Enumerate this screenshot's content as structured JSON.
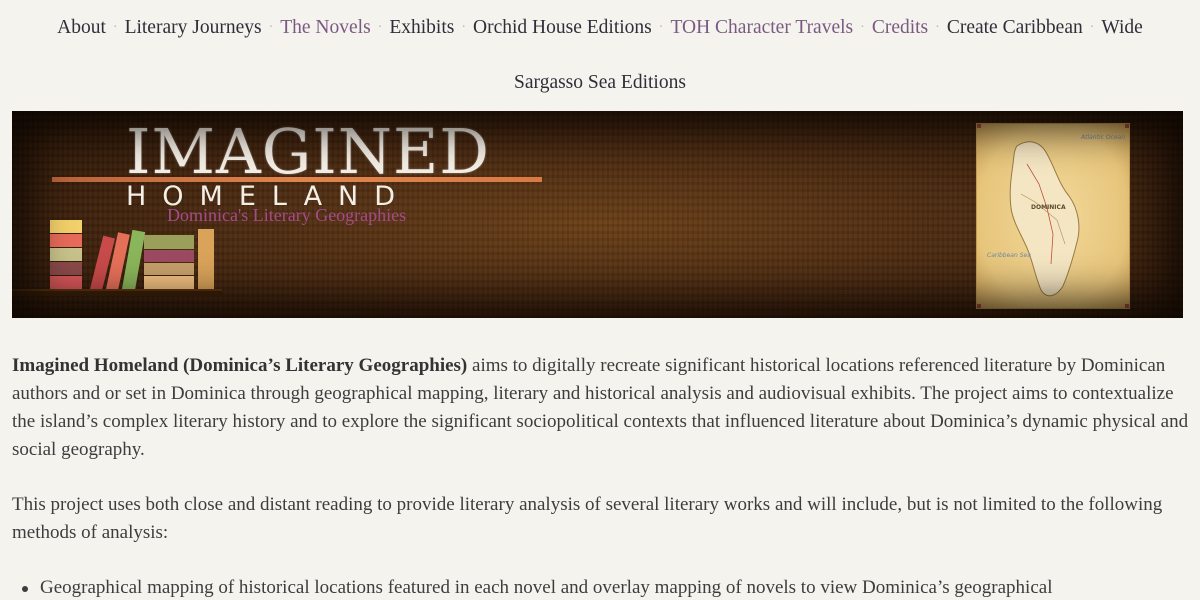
{
  "nav": {
    "items": [
      {
        "label": "About",
        "style": "dark"
      },
      {
        "label": "Literary Journeys",
        "style": "dark"
      },
      {
        "label": "The Novels",
        "style": "purple"
      },
      {
        "label": "Exhibits",
        "style": "dark"
      },
      {
        "label": "Orchid House Editions",
        "style": "dark"
      },
      {
        "label": "TOH Character Travels",
        "style": "purple"
      },
      {
        "label": "Credits",
        "style": "purple"
      },
      {
        "label": "Create Caribbean",
        "style": "dark"
      },
      {
        "label": "Wide",
        "style": "dark"
      }
    ],
    "continuation": "Sargasso Sea Editions",
    "separator": "·"
  },
  "banner": {
    "title": "IMAGINED",
    "subtitle": "HOMELAND",
    "tagline": "Dominica's Literary Geographies",
    "map_labels": [
      "Atlantic Ocean",
      "Caribbean Sea",
      "DOMINICA"
    ]
  },
  "content": {
    "intro_bold": "Imagined Homeland (Dominica’s Literary Geographies)",
    "intro_rest": " aims to digitally recreate significant historical locations referenced literature by Dominican authors and or set in Dominica through geographical mapping, literary and historical analysis and audiovisual exhibits. The project aims to contextualize the island’s complex literary history and to explore the significant sociopolitical contexts that influenced literature about Dominica’s dynamic physical and social geography.",
    "para2": "This project uses both close and distant reading to provide literary analysis of several literary works and will include, but is not limited to the following methods of analysis:",
    "bullets": [
      "Geographical mapping of historical locations featured in each novel and overlay mapping of novels to view Dominica’s geographical"
    ]
  },
  "colors": {
    "nav_dark": "#2f2f3a",
    "nav_purple": "#7a5a82",
    "banner_brown": "#4b2a10",
    "tagline_magenta": "#a64b8a",
    "background": "#f5f3ee"
  }
}
